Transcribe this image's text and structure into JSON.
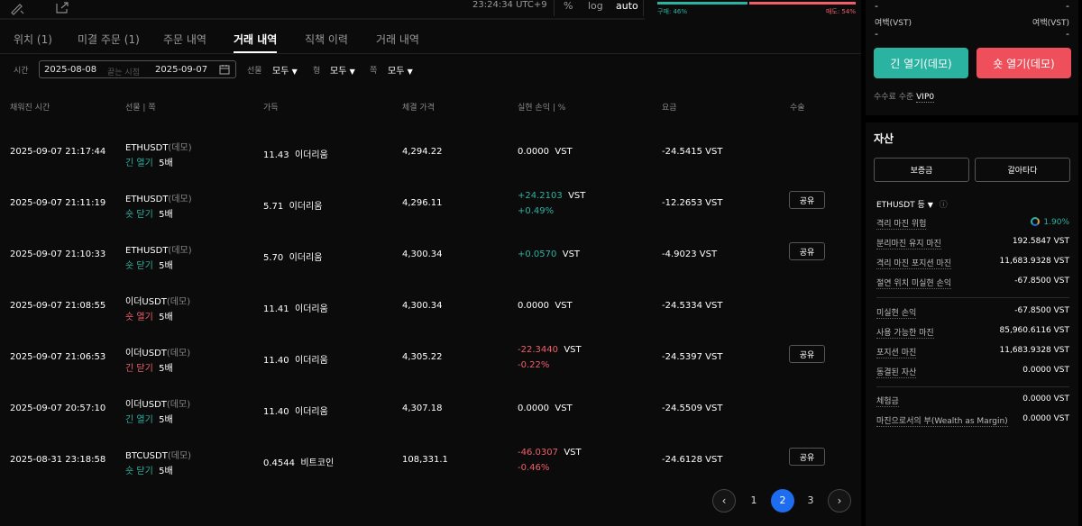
{
  "topbar": {
    "time": "23:24:34 UTC+9",
    "pct": "%",
    "log": "log",
    "auto": "auto"
  },
  "ratio": {
    "buy": "구매: 46%",
    "sell": "매도: 54%",
    "buy_fraction": 0.46
  },
  "tabs": [
    {
      "label": "위치 (1)"
    },
    {
      "label": "미결 주문 (1)"
    },
    {
      "label": "주문 내역"
    },
    {
      "label": "거래 내역"
    },
    {
      "label": "직책 이력"
    },
    {
      "label": "거래 내역"
    }
  ],
  "filters": {
    "time_label": "시간",
    "date_from": "2025-08-08",
    "date_sep": "끝는 시점",
    "date_to": "2025-09-07",
    "futures_label": "선물",
    "futures_value": "모두",
    "type_label": "형",
    "type_value": "모두",
    "side_label": "쪽",
    "side_value": "모두"
  },
  "table": {
    "headers": [
      "채워진 시간",
      "선물 | 쪽",
      "가득",
      "체결 가격",
      "실현 손익 | %",
      "요금",
      "수술"
    ],
    "rows": [
      {
        "time": "2025-09-07 21:17:44",
        "symbol": "ETHUSDT",
        "demo": "(데모)",
        "side": "긴 열기",
        "side_color": "green",
        "lev": "5배",
        "qty": "11.43",
        "unit": "이더리움",
        "price": "4,294.22",
        "pnl": "0.0000",
        "pnl_unit": "VST",
        "pnl_pct": "",
        "pnl_color": "white",
        "fee": "-24.5415",
        "fee_unit": "VST",
        "share": ""
      },
      {
        "time": "2025-09-07 21:11:19",
        "symbol": "ETHUSDT",
        "demo": "(데모)",
        "side": "숏 닫기",
        "side_color": "green",
        "lev": "5배",
        "qty": "5.71",
        "unit": "이더리움",
        "price": "4,296.11",
        "pnl": "+24.2103",
        "pnl_unit": "VST",
        "pnl_pct": "+0.49%",
        "pnl_color": "green",
        "fee": "-12.2653",
        "fee_unit": "VST",
        "share": "공유"
      },
      {
        "time": "2025-09-07 21:10:33",
        "symbol": "ETHUSDT",
        "demo": "(데모)",
        "side": "숏 닫기",
        "side_color": "green",
        "lev": "5배",
        "qty": "5.70",
        "unit": "이더리움",
        "price": "4,300.34",
        "pnl": "+0.0570",
        "pnl_unit": "VST",
        "pnl_pct": "",
        "pnl_color": "green",
        "fee": "-4.9023",
        "fee_unit": "VST",
        "share": "공유"
      },
      {
        "time": "2025-09-07 21:08:55",
        "symbol": "이더USDT",
        "demo": "(데모)",
        "side": "숏 열기",
        "side_color": "red",
        "lev": "5배",
        "qty": "11.41",
        "unit": "이더리움",
        "price": "4,300.34",
        "pnl": "0.0000",
        "pnl_unit": "VST",
        "pnl_pct": "",
        "pnl_color": "white",
        "fee": "-24.5334",
        "fee_unit": "VST",
        "share": ""
      },
      {
        "time": "2025-09-07 21:06:53",
        "symbol": "이더USDT",
        "demo": "(데모)",
        "side": "긴 닫기",
        "side_color": "red",
        "lev": "5배",
        "qty": "11.40",
        "unit": "이더리움",
        "price": "4,305.22",
        "pnl": "-22.3440",
        "pnl_unit": "VST",
        "pnl_pct": "-0.22%",
        "pnl_color": "red",
        "fee": "-24.5397",
        "fee_unit": "VST",
        "share": "공유"
      },
      {
        "time": "2025-09-07 20:57:10",
        "symbol": "이더USDT",
        "demo": "(데모)",
        "side": "긴 열기",
        "side_color": "green",
        "lev": "5배",
        "qty": "11.40",
        "unit": "이더리움",
        "price": "4,307.18",
        "pnl": "0.0000",
        "pnl_unit": "VST",
        "pnl_pct": "",
        "pnl_color": "white",
        "fee": "-24.5509",
        "fee_unit": "VST",
        "share": ""
      },
      {
        "time": "2025-08-31 23:18:58",
        "symbol": "BTCUSDT",
        "demo": "(데모)",
        "side": "숏 닫기",
        "side_color": "green",
        "lev": "5배",
        "qty": "0.4544",
        "unit": "비트코인",
        "price": "108,331.1",
        "pnl": "-46.0307",
        "pnl_unit": "VST",
        "pnl_pct": "-0.46%",
        "pnl_color": "red",
        "fee": "-24.6128",
        "fee_unit": "VST",
        "share": "공유"
      }
    ]
  },
  "pagination": {
    "prev": "‹",
    "pages": [
      "1",
      "2",
      "3"
    ],
    "active": "2",
    "next": "›"
  },
  "right": {
    "dash_left": "-",
    "dash_right": "-",
    "margin_left": "여백(VST)",
    "margin_right": "여백(VST)",
    "dash2_left": "-",
    "dash2_right": "-",
    "btn_long": "긴 열기(데모)",
    "btn_short": "숏 열기(데모)",
    "fee_label": "수수료 수준",
    "fee_value": "VIP0",
    "assets_title": "자산",
    "btn_deposit": "보증금",
    "btn_transfer": "갈아타다",
    "asset_symbol": "ETHUSDT 등",
    "rows": [
      {
        "k": "격리 마진 위험",
        "v": "1.90%"
      },
      {
        "k": "분리마진 유지 마진",
        "v": "192.5847 VST"
      },
      {
        "k": "격리 마진 포지션 마진",
        "v": "11,683.9328 VST"
      },
      {
        "k": "절연 위치 미실현 손익",
        "v": "-67.8500 VST"
      },
      {
        "k": "미실현 손익",
        "v": "-67.8500 VST"
      },
      {
        "k": "사용 가능한 마진",
        "v": "85,960.6116 VST"
      },
      {
        "k": "포지션 마진",
        "v": "11,683.9328 VST"
      },
      {
        "k": "동결된 자산",
        "v": "0.0000 VST"
      },
      {
        "k": "체험금",
        "v": "0.0000 VST"
      },
      {
        "k": "마진으로서의 부(Wealth as Margin)",
        "v": "0.0000 VST"
      }
    ]
  },
  "colors": {
    "green": "#2ab3a1",
    "red": "#ef5f6b",
    "accent": "#1e6cf0"
  }
}
